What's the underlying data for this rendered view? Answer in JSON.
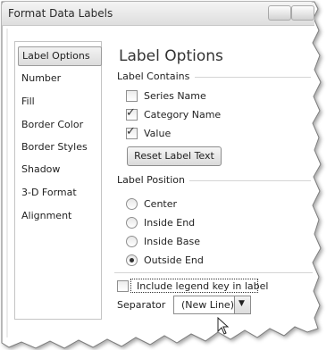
{
  "window": {
    "title": "Format Data Labels"
  },
  "nav": {
    "items": [
      {
        "label": "Label Options"
      },
      {
        "label": "Number"
      },
      {
        "label": "Fill"
      },
      {
        "label": "Border Color"
      },
      {
        "label": "Border Styles"
      },
      {
        "label": "Shadow"
      },
      {
        "label": "3-D Format"
      },
      {
        "label": "Alignment"
      }
    ],
    "selected": "Label Options"
  },
  "panel": {
    "title": "Label Options",
    "label_contains": {
      "heading": "Label Contains",
      "options": [
        {
          "label": "Series Name",
          "checked": false
        },
        {
          "label": "Category Name",
          "checked": true
        },
        {
          "label": "Value",
          "checked": true
        }
      ],
      "reset_button": "Reset Label Text"
    },
    "label_position": {
      "heading": "Label Position",
      "options": [
        {
          "label": "Center",
          "selected": false
        },
        {
          "label": "Inside End",
          "selected": false
        },
        {
          "label": "Inside Base",
          "selected": false
        },
        {
          "label": "Outside End",
          "selected": true
        }
      ]
    },
    "legend_key": {
      "label": "Include legend key in label",
      "checked": false
    },
    "separator": {
      "label": "Separator",
      "value": "(New Line)"
    }
  }
}
